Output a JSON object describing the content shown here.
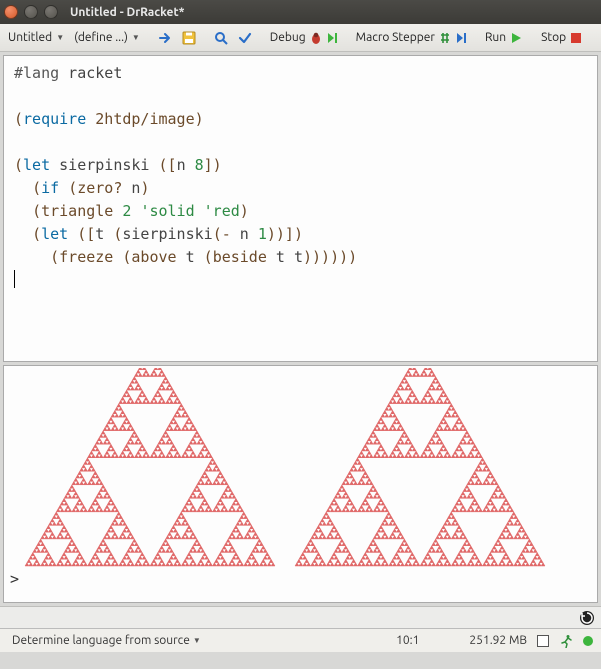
{
  "window": {
    "title": "Untitled - DrRacket*"
  },
  "toolbar": {
    "filename": "Untitled",
    "definitions": "(define ...)",
    "debug": "Debug",
    "macro": "Macro Stepper",
    "run": "Run",
    "stop": "Stop"
  },
  "code": {
    "lines": [
      [
        {
          "t": "#lang",
          "c": "#lang"
        },
        {
          "t": "txt",
          "c": " racket"
        }
      ],
      [],
      [
        {
          "t": "b",
          "c": "("
        },
        {
          "t": "kw",
          "c": "require"
        },
        {
          "t": "txt",
          "c": " "
        },
        {
          "t": "brown",
          "c": "2htdp/image"
        },
        {
          "t": "b",
          "c": ")"
        }
      ],
      [],
      [
        {
          "t": "b",
          "c": "("
        },
        {
          "t": "kw",
          "c": "let"
        },
        {
          "t": "txt",
          "c": " sierpinski "
        },
        {
          "t": "b",
          "c": "(["
        },
        {
          "t": "txt",
          "c": "n "
        },
        {
          "t": "num",
          "c": "8"
        },
        {
          "t": "b",
          "c": "])"
        }
      ],
      [
        {
          "t": "txt",
          "c": "  "
        },
        {
          "t": "b",
          "c": "("
        },
        {
          "t": "kw",
          "c": "if"
        },
        {
          "t": "txt",
          "c": " "
        },
        {
          "t": "b",
          "c": "("
        },
        {
          "t": "brown",
          "c": "zero?"
        },
        {
          "t": "txt",
          "c": " n"
        },
        {
          "t": "b",
          "c": ")"
        }
      ],
      [
        {
          "t": "txt",
          "c": "  "
        },
        {
          "t": "b",
          "c": "("
        },
        {
          "t": "brown",
          "c": "triangle"
        },
        {
          "t": "txt",
          "c": " "
        },
        {
          "t": "num",
          "c": "2"
        },
        {
          "t": "txt",
          "c": " "
        },
        {
          "t": "str",
          "c": "'solid"
        },
        {
          "t": "txt",
          "c": " "
        },
        {
          "t": "str",
          "c": "'red"
        },
        {
          "t": "b",
          "c": ")"
        }
      ],
      [
        {
          "t": "txt",
          "c": "  "
        },
        {
          "t": "b",
          "c": "("
        },
        {
          "t": "kw",
          "c": "let"
        },
        {
          "t": "txt",
          "c": " "
        },
        {
          "t": "b",
          "c": "(["
        },
        {
          "t": "txt",
          "c": "t "
        },
        {
          "t": "b",
          "c": "("
        },
        {
          "t": "txt",
          "c": "sierpinski"
        },
        {
          "t": "b",
          "c": "("
        },
        {
          "t": "brown",
          "c": "-"
        },
        {
          "t": "txt",
          "c": " n "
        },
        {
          "t": "num",
          "c": "1"
        },
        {
          "t": "b",
          "c": "))])"
        }
      ],
      [
        {
          "t": "txt",
          "c": "    "
        },
        {
          "t": "b",
          "c": "("
        },
        {
          "t": "brown",
          "c": "freeze"
        },
        {
          "t": "txt",
          "c": " "
        },
        {
          "t": "b",
          "c": "("
        },
        {
          "t": "brown",
          "c": "above"
        },
        {
          "t": "txt",
          "c": " t "
        },
        {
          "t": "b",
          "c": "("
        },
        {
          "t": "brown",
          "c": "beside"
        },
        {
          "t": "txt",
          "c": " t t"
        },
        {
          "t": "b",
          "c": "))))))"
        }
      ]
    ]
  },
  "interactions": {
    "prompt": ">"
  },
  "status": {
    "language": "Determine language from source",
    "position": "10:1",
    "memory": "251.92 MB"
  },
  "colors": {
    "fractal": "#e06868"
  }
}
